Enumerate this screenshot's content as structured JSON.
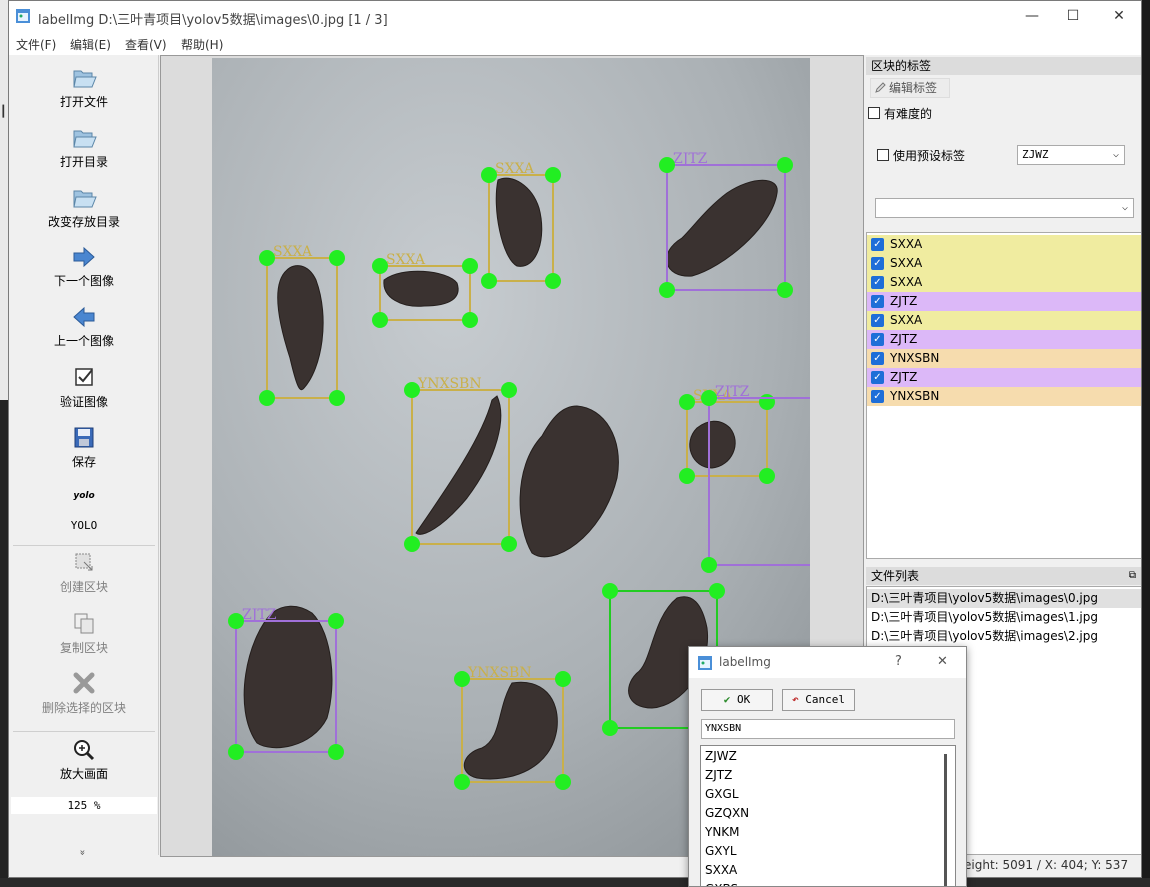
{
  "window": {
    "title": "labelImg D:\\三叶青项目\\yolov5数据\\images\\0.jpg [1 / 3]",
    "minimize": "—",
    "maximize": "☐",
    "close": "✕"
  },
  "menu": [
    "文件(F)",
    "编辑(E)",
    "查看(V)",
    "帮助(H)"
  ],
  "toolbar": {
    "open_file": "打开文件",
    "open_dir": "打开目录",
    "change_save_dir": "改变存放目录",
    "next_image": "下一个图像",
    "prev_image": "上一个图像",
    "verify_image": "验证图像",
    "save": "保存",
    "yolo_icon_text": "yolo",
    "yolo": "YOLO",
    "create_box": "创建区块",
    "duplicate_box": "复制区块",
    "delete_box": "删除选择的区块",
    "zoom_in": "放大画面",
    "zoom_level": "125 %",
    "more": "»"
  },
  "annotations": [
    {
      "label": "SXXA",
      "color": "#c9b04a"
    },
    {
      "label": "SXXA",
      "color": "#c9b04a"
    },
    {
      "label": "SXXA",
      "color": "#c9b04a"
    },
    {
      "label": "ZJTZ",
      "color": "#a070d8"
    },
    {
      "label": "SXXA",
      "color": "#c9b04a"
    },
    {
      "label": "ZJTZ",
      "color": "#a070d8"
    },
    {
      "label": "YNXSBN",
      "color": "#c9b04a"
    },
    {
      "label": "ZJTZ",
      "color": "#a070d8"
    },
    {
      "label": "YNXSBN",
      "color": "#c9b04a"
    }
  ],
  "right_panel": {
    "box_labels_title": "区块的标签",
    "edit_label_btn": "编辑标签",
    "difficult": "有难度的",
    "use_default_label": "使用预设标签",
    "default_label_value": "ZJWZ",
    "label_filter_value": "",
    "labels": [
      {
        "text": "SXXA",
        "bg": "#f0eca0"
      },
      {
        "text": "SXXA",
        "bg": "#f0eca0"
      },
      {
        "text": "SXXA",
        "bg": "#f0eca0"
      },
      {
        "text": "ZJTZ",
        "bg": "#dcb8f8"
      },
      {
        "text": "SXXA",
        "bg": "#f0eca0"
      },
      {
        "text": "ZJTZ",
        "bg": "#dcb8f8"
      },
      {
        "text": "YNXSBN",
        "bg": "#f6dcae"
      },
      {
        "text": "ZJTZ",
        "bg": "#dcb8f8"
      },
      {
        "text": "YNXSBN",
        "bg": "#f6dcae"
      }
    ],
    "file_list_title": "文件列表",
    "files": [
      "D:\\三叶青项目\\yolov5数据\\images\\0.jpg",
      "D:\\三叶青项目\\yolov5数据\\images\\1.jpg",
      "D:\\三叶青项目\\yolov5数据\\images\\2.jpg"
    ]
  },
  "status_bar": "Height: 5091 / X: 404; Y: 537",
  "dialog": {
    "title": "labelImg",
    "help": "?",
    "close": "✕",
    "ok": "OK",
    "cancel": "Cancel",
    "input_value": "YNXSBN",
    "options": [
      "ZJWZ",
      "ZJTZ",
      "GXGL",
      "GZQXN",
      "YNKM",
      "GXYL",
      "SXXA",
      "GXBS"
    ]
  }
}
